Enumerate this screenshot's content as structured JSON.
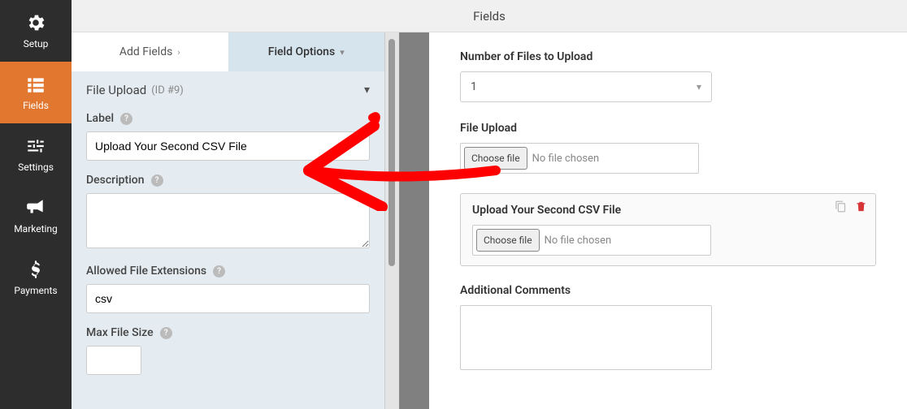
{
  "header": {
    "title": "Fields"
  },
  "sidebar": {
    "items": [
      {
        "label": "Setup"
      },
      {
        "label": "Fields"
      },
      {
        "label": "Settings"
      },
      {
        "label": "Marketing"
      },
      {
        "label": "Payments"
      }
    ]
  },
  "tabs": {
    "add_fields": "Add Fields",
    "field_options": "Field Options"
  },
  "panel": {
    "title": "File Upload",
    "id_text": "(ID #9)",
    "label_heading": "Label",
    "label_value": "Upload Your Second CSV File",
    "description_heading": "Description",
    "description_value": "",
    "allowed_ext_heading": "Allowed File Extensions",
    "allowed_ext_value": "csv",
    "max_size_heading": "Max File Size",
    "max_size_value": ""
  },
  "preview": {
    "num_files_label": "Number of Files to Upload",
    "num_files_value": "1",
    "file_upload_label": "File Upload",
    "choose_file_btn": "Choose file",
    "no_file_text": "No file chosen",
    "second_label": "Upload Your Second CSV File",
    "comments_label": "Additional Comments"
  }
}
